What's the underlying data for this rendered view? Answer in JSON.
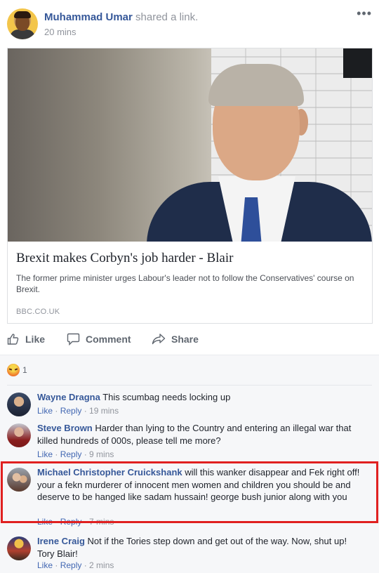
{
  "post": {
    "author": "Muhammad Umar",
    "action": "shared a link.",
    "time": "20 mins",
    "more_icon": "ellipsis-icon"
  },
  "link": {
    "title": "Brexit makes Corbyn's job harder - Blair",
    "description": "The former prime minister urges Labour's leader not to follow the Conservatives' course on Brexit.",
    "source": "BBC.CO.UK"
  },
  "actions": {
    "like": "Like",
    "comment": "Comment",
    "share": "Share"
  },
  "reactions": {
    "icon": "angry-reaction-icon",
    "count": "1"
  },
  "comments": [
    {
      "name": "Wayne Dragna",
      "text": "This scumbag needs locking up",
      "like": "Like",
      "reply": "Reply",
      "time": "19 mins"
    },
    {
      "name": "Steve Brown",
      "text": "Harder than lying to the Country and entering an illegal war that killed hundreds of 000s, please tell me more?",
      "like": "Like",
      "reply": "Reply",
      "time": "9 mins"
    },
    {
      "name": "Michael Christopher Cruickshank",
      "text": "will this wanker disappear and Fek right off! your a fekn murderer of innocent men women and children you should be and deserve to be hanged like sadam hussain! george bush junior along with you",
      "like": "Like",
      "reply": "Reply",
      "time": "7 mins"
    },
    {
      "name": "Irene Craig",
      "text": "Not if the Tories step down and get out of the way. Now, shut up! Tory Blair!",
      "like": "Like",
      "reply": "Reply",
      "time": "2 mins"
    }
  ],
  "colors": {
    "link_blue": "#365899",
    "meta_grey": "#90949c",
    "highlight_red": "#e02020"
  }
}
